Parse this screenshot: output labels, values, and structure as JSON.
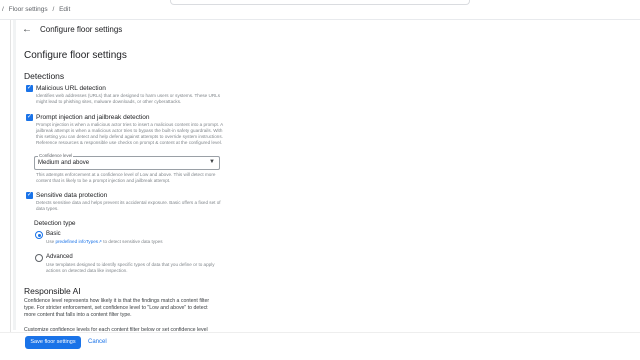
{
  "breadcrumb": {
    "sep": "/",
    "parent": "Floor settings",
    "current": "Edit"
  },
  "header": {
    "back_icon": "arrow-left-icon",
    "title": "Configure floor settings"
  },
  "page": {
    "title": "Configure floor settings"
  },
  "detections": {
    "heading": "Detections",
    "malicious": {
      "checked": true,
      "label": "Malicious URL detection",
      "description": "Identifies web addresses (URLs) that are designed to harm users or systems. These URLs might lead to phishing sites, malware downloads, or other cyberattacks."
    },
    "prompt": {
      "checked": true,
      "label": "Prompt injection and jailbreak detection",
      "description": "Prompt injection is when a malicious actor tries to insert a malicious content into a prompt. A jailbreak attempt is when a malicious actor tries to bypass the built-in safety guardrails. With this setting you can detect and help defend against attempts to override system instructions. Reference resources & responsible use checks on prompt & content at the configured level."
    },
    "confidence": {
      "float_label": "Confidence level",
      "value": "Medium and above",
      "arrow_icon": "caret-down-icon",
      "helper": "This attempts enforcement at a confidence level of Low and above. This will detect more content that is likely to be a prompt injection and jailbreak attempt."
    },
    "sensitive": {
      "checked": true,
      "label": "Sensitive data protection",
      "description": "Detects sensitive data and helps prevent its accidental exposure. Basic offers a fixed set of data types."
    },
    "detection_type": {
      "heading": "Detection type",
      "basic": {
        "label": "Basic",
        "desc_prefix": "Use ",
        "link": "predefined infoTypes",
        "desc_suffix": " to detect sensitive data types"
      },
      "advanced": {
        "label": "Advanced",
        "description": "Use templates designed to identify specific types of data that you define or to apply actions on detected data like inspection."
      }
    }
  },
  "responsible_ai": {
    "heading": "Responsible AI",
    "para1": "Confidence level represents how likely it is that the findings match a content filter type. For stricter enforcement, set confidence level to \"Low and above\" to detect more content that falls into a content filter type.",
    "para2": "Customize confidence levels for each content filter below or set confidence level"
  },
  "footer": {
    "save_label": "Save floor settings",
    "cancel_label": "Cancel"
  },
  "colors": {
    "accent": "#1a73e8"
  }
}
